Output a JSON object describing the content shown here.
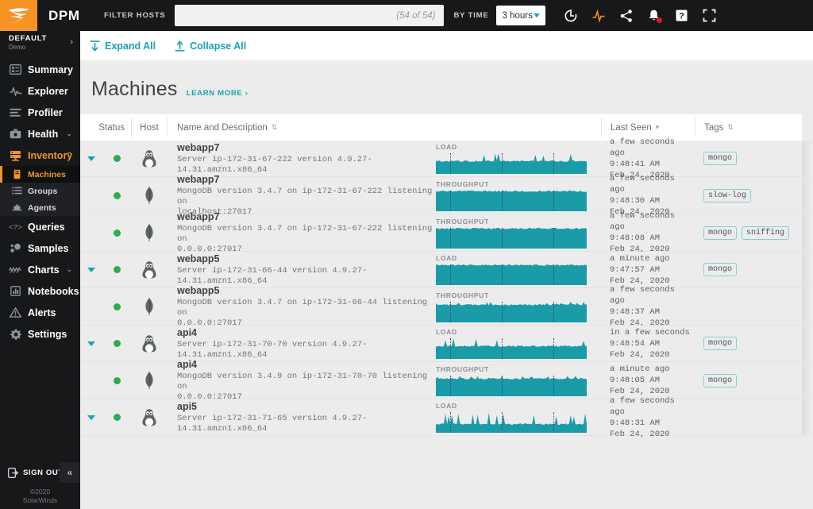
{
  "topbar": {
    "brand": "DPM",
    "filter_label": "FILTER HOSTS",
    "filter_value": "",
    "filter_placeholder": "",
    "filter_count": "(54 of 54)",
    "bytime_label": "BY TIME",
    "time_range": "3 hours",
    "icons": [
      "refresh-icon",
      "activity-icon",
      "share-icon",
      "notifications-icon",
      "help-icon",
      "fullscreen-icon"
    ]
  },
  "sidebar": {
    "org_name": "DEFAULT",
    "org_sub": "Demo",
    "items": [
      {
        "label": "Summary",
        "icon": "summary-icon",
        "chevron": ""
      },
      {
        "label": "Explorer",
        "icon": "explorer-icon",
        "chevron": ""
      },
      {
        "label": "Profiler",
        "icon": "profiler-icon",
        "chevron": ""
      },
      {
        "label": "Health",
        "icon": "health-icon",
        "chevron": "⌄"
      },
      {
        "label": "Inventory",
        "icon": "inventory-icon",
        "chevron": "⌃"
      },
      {
        "label": "Queries",
        "icon": "queries-icon",
        "chevron": ""
      },
      {
        "label": "Samples",
        "icon": "samples-icon",
        "chevron": ""
      },
      {
        "label": "Charts",
        "icon": "charts-icon",
        "chevron": "⌄"
      },
      {
        "label": "Notebooks",
        "icon": "notebooks-icon",
        "chevron": ""
      },
      {
        "label": "Alerts",
        "icon": "alerts-icon",
        "chevron": ""
      },
      {
        "label": "Settings",
        "icon": "settings-icon",
        "chevron": ""
      }
    ],
    "subitems": [
      {
        "label": "Machines",
        "icon": "machines-icon",
        "current": true
      },
      {
        "label": "Groups",
        "icon": "groups-icon",
        "current": false
      },
      {
        "label": "Agents",
        "icon": "agents-icon",
        "current": false
      }
    ],
    "sign_out": "SIGN OUT",
    "collapse_icon": "«",
    "copyright_line1": "©2020",
    "copyright_line2": "SolarWinds"
  },
  "actions": {
    "expand_all": "Expand All",
    "collapse_all": "Collapse All"
  },
  "page": {
    "title": "Machines",
    "learn_more": "LEARN MORE ›"
  },
  "table": {
    "headers": {
      "status": "Status",
      "host": "Host",
      "name": "Name and Description",
      "name_sort": "⇅",
      "last_seen": "Last Seen",
      "last_seen_sort": "▾",
      "tags": "Tags",
      "tags_sort": "⇅"
    },
    "rows": [
      {
        "expandable": true,
        "status": "ok",
        "host_icon": "linux-penguin-icon",
        "name": "webapp7",
        "description": "Server ip-172-31-67-222 version 4.9.27-14.31.amzn1.x86_64",
        "spark_label": "LOAD",
        "spark_type": "spiky-low",
        "seen_rel": "a few seconds ago",
        "seen_time": "9:48:41 AM",
        "seen_date": "Feb 24, 2020",
        "tags": [
          "mongo"
        ]
      },
      {
        "expandable": false,
        "status": "ok",
        "host_icon": "mongodb-leaf-icon",
        "name": "webapp7",
        "description": "MongoDB version 3.4.7 on ip-172-31-67-222 listening on\nlocalhost:27017",
        "spark_label": "THROUGHPUT",
        "spark_type": "flat",
        "seen_rel": "a few seconds ago",
        "seen_time": "9:48:30 AM",
        "seen_date": "Feb 24, 2020",
        "tags": [
          "slow-log"
        ]
      },
      {
        "expandable": false,
        "status": "ok",
        "host_icon": "mongodb-leaf-icon",
        "name": "webapp7",
        "description": "MongoDB version 3.4.7 on ip-172-31-67-222 listening on\n0.0.0.0:27017",
        "spark_label": "THROUGHPUT",
        "spark_type": "flat",
        "seen_rel": "a few seconds ago",
        "seen_time": "9:48:08 AM",
        "seen_date": "Feb 24, 2020",
        "tags": [
          "mongo",
          "sniffing"
        ]
      },
      {
        "expandable": true,
        "status": "ok",
        "host_icon": "linux-penguin-icon",
        "name": "webapp5",
        "description": "Server ip-172-31-66-44 version 4.9.27-14.31.amzn1.x86_64",
        "spark_label": "LOAD",
        "spark_type": "flat",
        "seen_rel": "a minute ago",
        "seen_time": "9:47:57 AM",
        "seen_date": "Feb 24, 2020",
        "tags": [
          "mongo"
        ]
      },
      {
        "expandable": false,
        "status": "ok",
        "host_icon": "mongodb-leaf-icon",
        "name": "webapp5",
        "description": "MongoDB version 3.4.7 on ip-172-31-66-44 listening on\n0.0.0.0:27017",
        "spark_label": "THROUGHPUT",
        "spark_type": "noisy",
        "seen_rel": "a few seconds ago",
        "seen_time": "9:48:37 AM",
        "seen_date": "Feb 24, 2020",
        "tags": []
      },
      {
        "expandable": true,
        "status": "ok",
        "host_icon": "linux-penguin-icon",
        "name": "api4",
        "description": "Server ip-172-31-70-70 version 4.9.27-14.31.amzn1.x86_64",
        "spark_label": "LOAD",
        "spark_type": "spiky-low",
        "seen_rel": "in a few seconds",
        "seen_time": "9:48:54 AM",
        "seen_date": "Feb 24, 2020",
        "tags": [
          "mongo"
        ]
      },
      {
        "expandable": false,
        "status": "ok",
        "host_icon": "mongodb-leaf-icon",
        "name": "api4",
        "description": "MongoDB version 3.4.9 on ip-172-31-70-70 listening on\n0.0.0.0:27017",
        "spark_label": "THROUGHPUT",
        "spark_type": "noisy",
        "seen_rel": "a minute ago",
        "seen_time": "9:48:05 AM",
        "seen_date": "Feb 24, 2020",
        "tags": [
          "mongo"
        ]
      },
      {
        "expandable": true,
        "status": "ok",
        "host_icon": "linux-penguin-icon",
        "name": "api5",
        "description": "Server ip-172-31-71-65 version 4.9.27-14.31.amzn1.x86_64",
        "spark_label": "LOAD",
        "spark_type": "spiky-high",
        "seen_rel": "a few seconds ago",
        "seen_time": "9:48:31 AM",
        "seen_date": "Feb 24, 2020",
        "tags": []
      }
    ]
  },
  "colors": {
    "brand_orange": "#f59324",
    "teal": "#17a2b8",
    "spark_teal": "#1a9ba8",
    "status_green": "#2fab4f",
    "dark": "#17181a"
  }
}
